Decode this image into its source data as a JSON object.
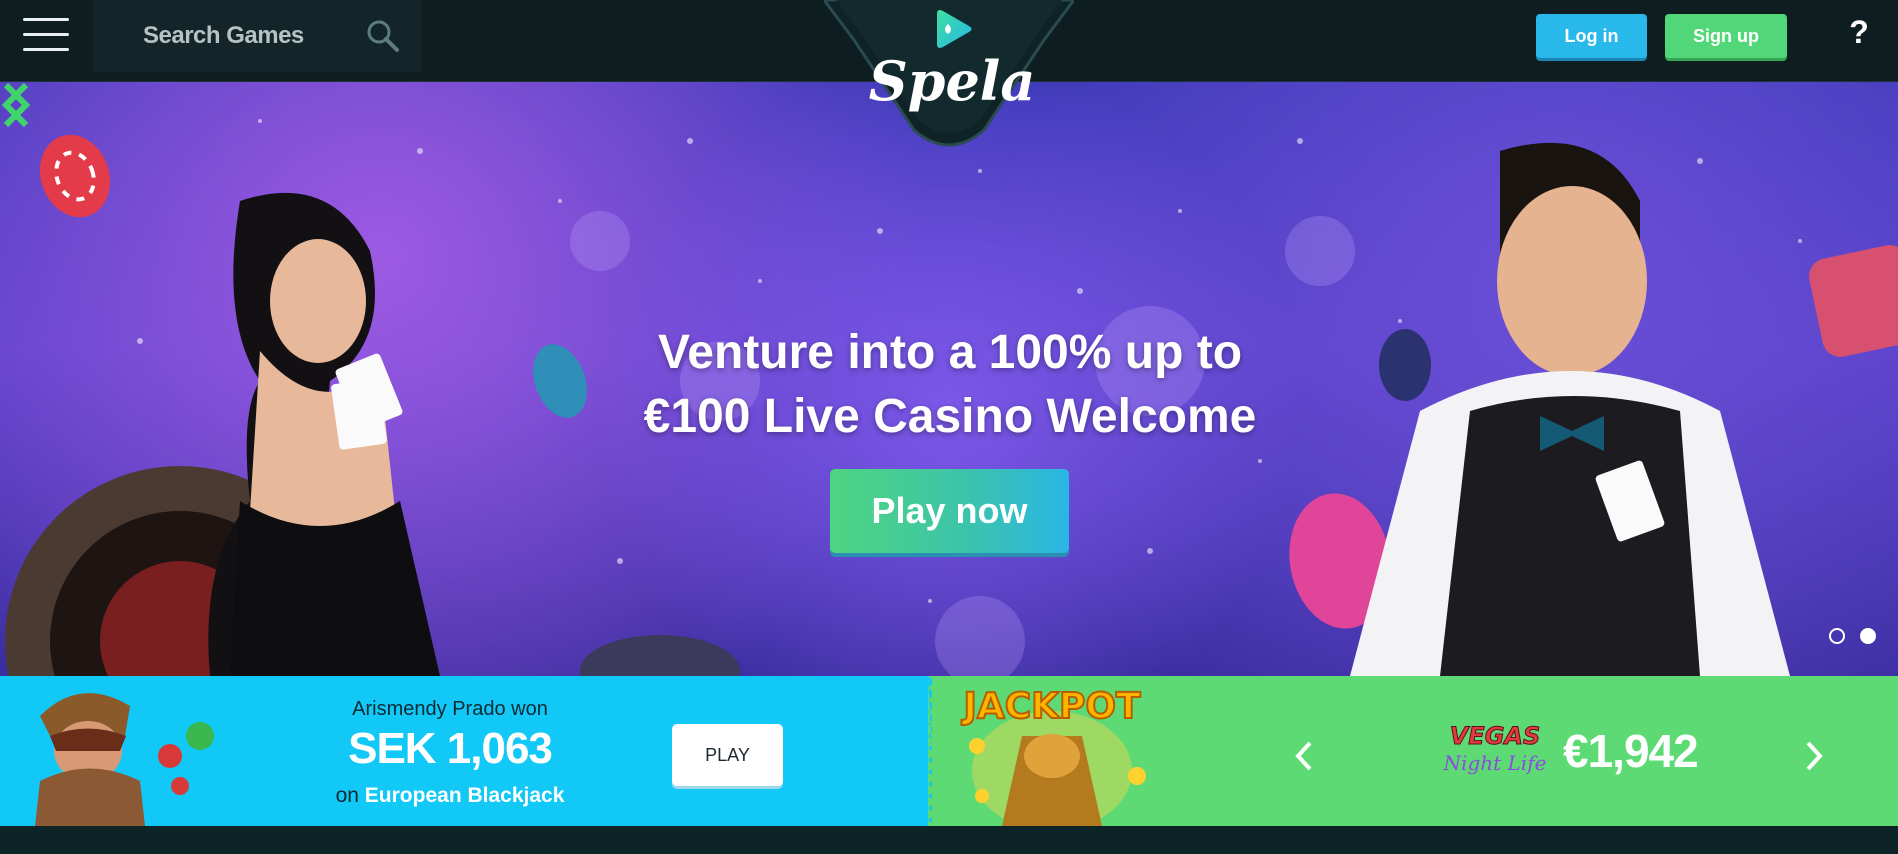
{
  "header": {
    "search_placeholder": "Search Games",
    "brand_name": "Spela",
    "login_label": "Log in",
    "signup_label": "Sign up",
    "help_label": "?"
  },
  "hero": {
    "title_line1": "Venture into a 100% up to",
    "title_line2": "€100 Live Casino Welcome",
    "cta_label": "Play now",
    "slides_total": 2,
    "active_slide": 2
  },
  "winner": {
    "name_text": "Arismendy Prado won",
    "amount": "SEK 1,063",
    "on_text": "on",
    "game": "European Blackjack",
    "play_label": "PLAY"
  },
  "jackpot": {
    "badge": "JACKPOT",
    "game_logo_top": "VEGAS",
    "game_logo_bottom": "Night Life",
    "amount": "€1,942"
  },
  "colors": {
    "header_bg": "#0e1d1f",
    "login": "#29b8ea",
    "signup": "#52d778",
    "winner_bg": "#12c8f7",
    "jackpot_bg": "#5dda73",
    "arrow_green": "#3fd56a"
  },
  "icons": [
    "hamburger-menu-icon",
    "search-icon",
    "chevron-left-icon",
    "chevron-right-icon"
  ]
}
